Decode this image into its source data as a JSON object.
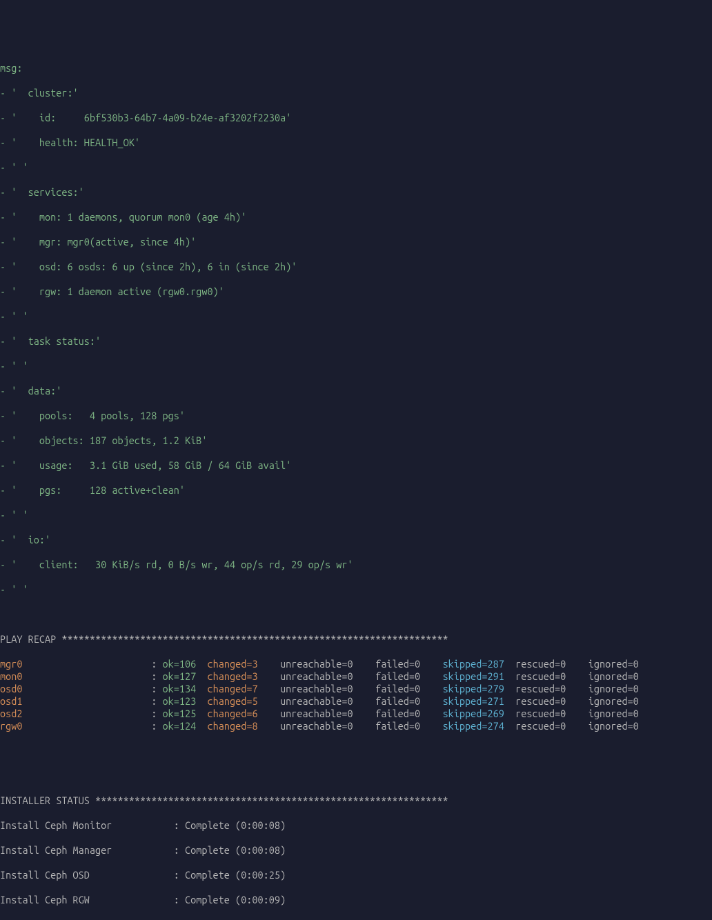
{
  "msg_label": "msg:",
  "msg_lines": [
    "- '  cluster:'",
    "- '    id:     6bf530b3-64b7-4a09-b24e-af3202f2230a'",
    "- '    health: HEALTH_OK'",
    "- ' '",
    "- '  services:'",
    "- '    mon: 1 daemons, quorum mon0 (age 4h)'",
    "- '    mgr: mgr0(active, since 4h)'",
    "- '    osd: 6 osds: 6 up (since 2h), 6 in (since 2h)'",
    "- '    rgw: 1 daemon active (rgw0.rgw0)'",
    "- ' '",
    "- '  task status:'",
    "- ' '",
    "- '  data:'",
    "- '    pools:   4 pools, 128 pgs'",
    "- '    objects: 187 objects, 1.2 KiB'",
    "- '    usage:   3.1 GiB used, 58 GiB / 64 GiB avail'",
    "- '    pgs:     128 active+clean'",
    "- ' '",
    "- '  io:'",
    "- '    client:   30 KiB/s rd, 0 B/s wr, 44 op/s rd, 29 op/s wr'",
    "- ' '"
  ],
  "play_recap_header": "PLAY RECAP *********************************************************************",
  "recap_rows": [
    {
      "host": "mgr0",
      "ok": "ok=106",
      "changed": "changed=3",
      "unreachable": "unreachable=0",
      "failed": "failed=0",
      "skipped": "skipped=287",
      "rescued": "rescued=0",
      "ignored": "ignored=0"
    },
    {
      "host": "mon0",
      "ok": "ok=127",
      "changed": "changed=3",
      "unreachable": "unreachable=0",
      "failed": "failed=0",
      "skipped": "skipped=291",
      "rescued": "rescued=0",
      "ignored": "ignored=0"
    },
    {
      "host": "osd0",
      "ok": "ok=134",
      "changed": "changed=7",
      "unreachable": "unreachable=0",
      "failed": "failed=0",
      "skipped": "skipped=279",
      "rescued": "rescued=0",
      "ignored": "ignored=0"
    },
    {
      "host": "osd1",
      "ok": "ok=123",
      "changed": "changed=5",
      "unreachable": "unreachable=0",
      "failed": "failed=0",
      "skipped": "skipped=271",
      "rescued": "rescued=0",
      "ignored": "ignored=0"
    },
    {
      "host": "osd2",
      "ok": "ok=125",
      "changed": "changed=6",
      "unreachable": "unreachable=0",
      "failed": "failed=0",
      "skipped": "skipped=269",
      "rescued": "rescued=0",
      "ignored": "ignored=0"
    },
    {
      "host": "rgw0",
      "ok": "ok=124",
      "changed": "changed=8",
      "unreachable": "unreachable=0",
      "failed": "failed=0",
      "skipped": "skipped=274",
      "rescued": "rescued=0",
      "ignored": "ignored=0"
    }
  ],
  "installer_header": "INSTALLER STATUS ***************************************************************",
  "installer_lines": [
    "Install Ceph Monitor           : Complete (0:00:08)",
    "Install Ceph Manager           : Complete (0:00:08)",
    "Install Ceph OSD               : Complete (0:00:25)",
    "Install Ceph RGW               : Complete (0:00:09)"
  ]
}
